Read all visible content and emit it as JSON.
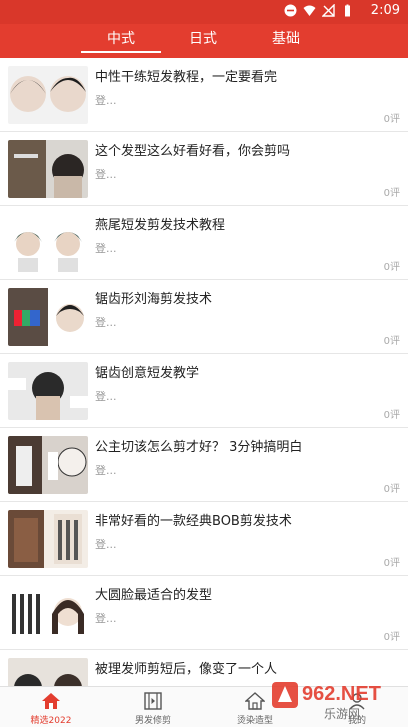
{
  "status_bar": {
    "time": "2:09"
  },
  "tabs": [
    {
      "label": "中式",
      "active": true
    },
    {
      "label": "日式",
      "active": false
    },
    {
      "label": "基础",
      "active": false
    }
  ],
  "articles": [
    {
      "title": "中性干练短发教程，一定要看完",
      "meta": "登...",
      "count": "0评"
    },
    {
      "title": "这个发型这么好看好看，你会剪吗",
      "meta": "登...",
      "count": "0评"
    },
    {
      "title": "燕尾短发剪发技术教程",
      "meta": "登...",
      "count": "0评"
    },
    {
      "title": "锯齿形刘海剪发技术",
      "meta": "登...",
      "count": "0评"
    },
    {
      "title": "锯齿创意短发教学",
      "meta": "登...",
      "count": "0评"
    },
    {
      "title": "公主切该怎么剪才好？ 3分钟搞明白",
      "meta": "登...",
      "count": "0评"
    },
    {
      "title": "非常好看的一款经典BOB剪发技术",
      "meta": "登...",
      "count": "0评"
    },
    {
      "title": "大圆脸最适合的发型",
      "meta": "登...",
      "count": "0评"
    },
    {
      "title": "被理发师剪短后，像变了一个人",
      "meta": "",
      "count": ""
    }
  ],
  "bottom_nav": [
    {
      "label": "精选2022",
      "icon": "home-icon",
      "active": true
    },
    {
      "label": "男发修剪",
      "icon": "video-icon",
      "active": false
    },
    {
      "label": "烫染造型",
      "icon": "house-icon",
      "active": false
    },
    {
      "label": "我的",
      "icon": "user-icon",
      "active": false
    }
  ],
  "watermark": {
    "text": "962.NET",
    "subtext": "乐游网"
  },
  "colors": {
    "primary": "#e33d2f",
    "status": "#d9372a"
  }
}
